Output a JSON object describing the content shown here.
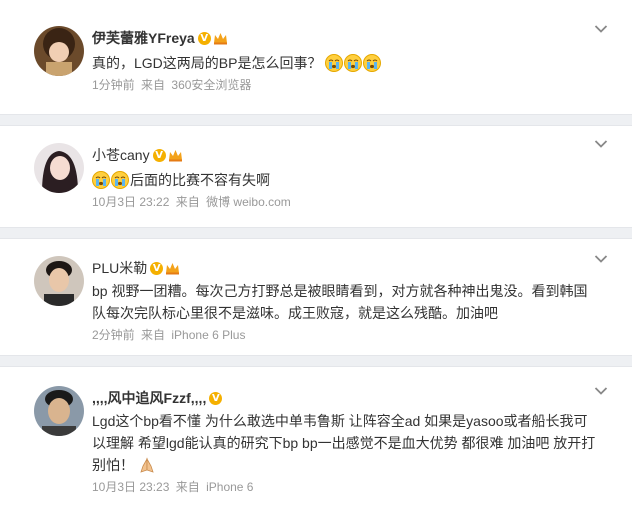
{
  "posts": [
    {
      "username": "伊芙蕾雅YFreya",
      "verified_badge": "V",
      "text": "真的，LGD这两局的BP是怎么回事？",
      "time": "1分钟前",
      "source_prefix": "来自",
      "source": "360安全浏览器",
      "emoji": [
        "crying-face",
        "crying-face",
        "crying-face"
      ]
    },
    {
      "username": "小苍cany",
      "verified_badge": "V",
      "text": "后面的比赛不容有失啊",
      "time": "10月3日 23:22",
      "source_prefix": "来自",
      "source": "微博 weibo.com",
      "emoji": [
        "crying-face",
        "crying-face"
      ]
    },
    {
      "username": "PLU米勒",
      "verified_badge": "V",
      "text": "bp 视野一团糟。每次己方打野总是被眼睛看到，对方就各种神出鬼没。看到韩国队每次完队标心里很不是滋味。成王败寇，就是这么残酷。加油吧",
      "time": "2分钟前",
      "source_prefix": "来自",
      "source": "iPhone 6 Plus"
    },
    {
      "username": ",,,,风中追风Fzzf,,,,",
      "verified_badge": "V",
      "text": "Lgd这个bp看不懂 为什么敢选中单韦鲁斯 让阵容全ad 如果是yasoo或者船长我可以理解 希望lgd能认真的研究下bp bp一出感觉不是血大优势 都很难 加油吧 放开打 别怕！",
      "time": "10月3日 23:23",
      "source_prefix": "来自",
      "source": "iPhone 6",
      "emoji": [
        "folded-hands"
      ]
    }
  ],
  "colors": {
    "text": "#333333",
    "meta": "#999999",
    "badge": "#f5b000",
    "separator": "#eef0f3"
  }
}
